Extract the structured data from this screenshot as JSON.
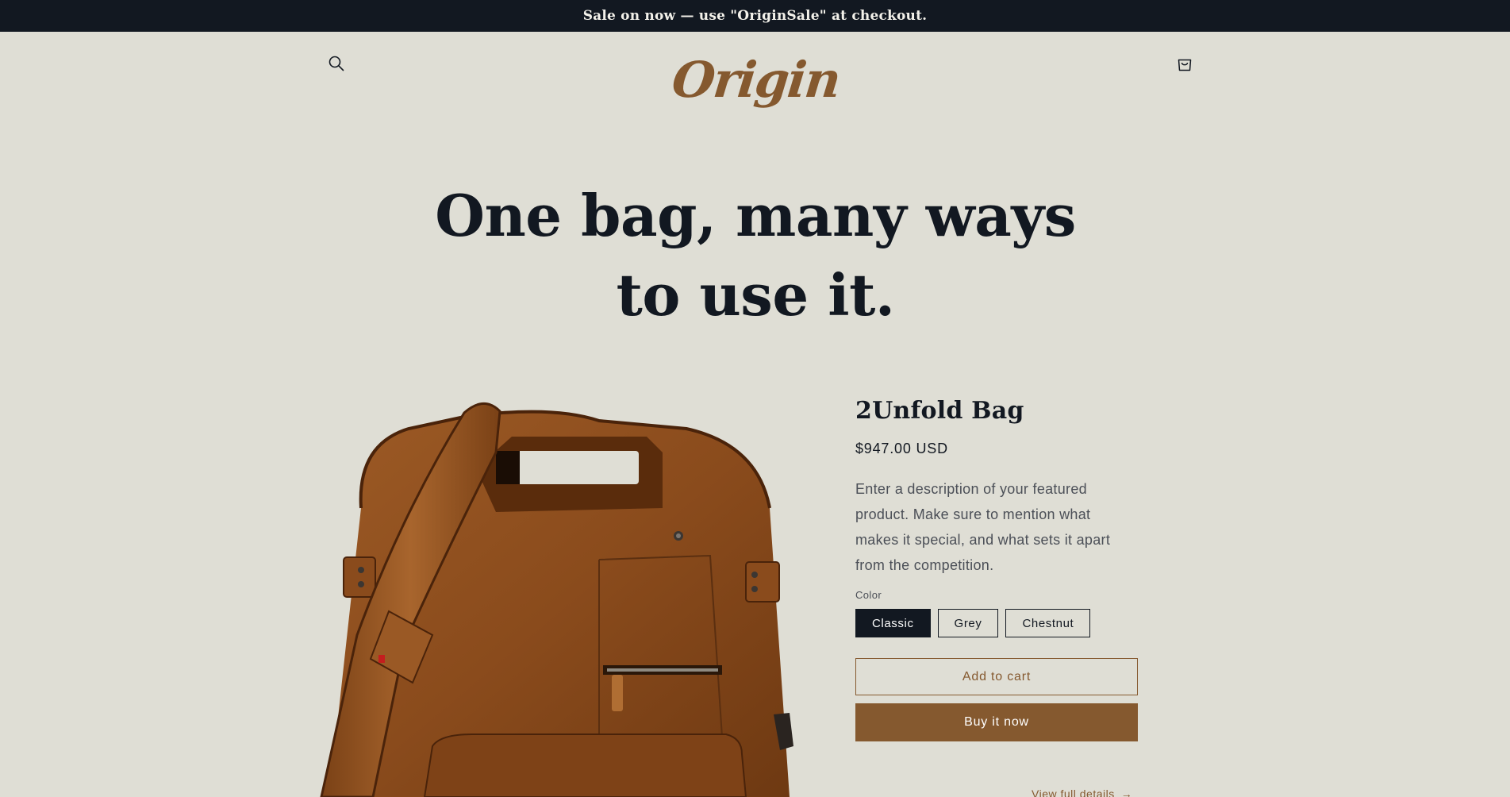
{
  "announcement": {
    "text": "Sale on now — use \"OriginSale\" at checkout."
  },
  "header": {
    "logo_text": "Origin",
    "search_icon": "search-icon",
    "cart_icon": "cart-icon"
  },
  "hero": {
    "line1": "One bag, many ways",
    "line2": "to use it."
  },
  "product": {
    "title": "2Unfold Bag",
    "price": "$947.00 USD",
    "description": "Enter a description of your featured product. Make sure to mention what makes it special, and what sets it apart from the competition.",
    "color_label": "Color",
    "colors": [
      "Classic",
      "Grey",
      "Chestnut"
    ],
    "selected_color": "Classic",
    "add_to_cart": "Add to cart",
    "buy_now": "Buy it now",
    "view_details": "View full details",
    "image_icon": "leather-bag-image"
  },
  "colors": {
    "dark": "#121821",
    "accent": "#85592f",
    "background": "#dfded5"
  }
}
